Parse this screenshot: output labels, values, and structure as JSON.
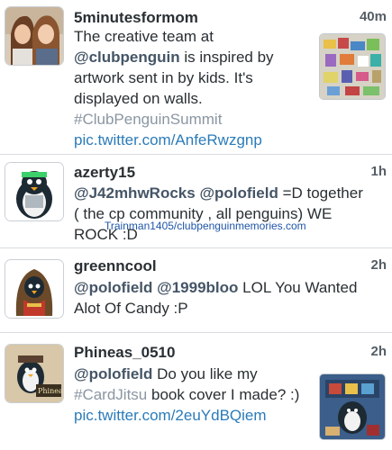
{
  "tweets": [
    {
      "username": "5minutesformom",
      "time": "40m",
      "line1": "The creative team at",
      "mention1": "@clubpenguin",
      "line2_rest": " is inspired by",
      "line3": "artwork sent in by kids. It's",
      "line4": "displayed on walls.",
      "hashtag": "#ClubPenguinSummit",
      "link": "pic.twitter.com/AnfeRwzgnp",
      "avatar_icon": "two-women-photo",
      "thumbnail_icon": "artwork-wall-photo"
    },
    {
      "username": "azerty15",
      "time": "1h",
      "mention1": "@J42mhwRocks",
      "mention2": "@polofield",
      "line1_rest": " =D together",
      "line2": "( the cp community , all penguins) WE",
      "line3": "ROCK :D",
      "avatar_icon": "penguin-avatar"
    },
    {
      "username": "greenncool",
      "time": "2h",
      "mention1": "@polofield",
      "mention2": "@1999bloo",
      "line1_rest": " LOL You Wanted",
      "line2": "Alot Of Candy :P",
      "avatar_icon": "hooded-penguin-avatar"
    },
    {
      "username": "Phineas_0510",
      "time": "2h",
      "mention1": "@polofield",
      "line1_rest": " Do you like my",
      "hashtag": "#CardJitsu",
      "line2_rest": " book cover I made? :)",
      "link": "pic.twitter.com/2euYdBQiem",
      "avatar_icon": "phineas-penguin-avatar",
      "thumbnail_icon": "book-cover-photo"
    }
  ],
  "watermark": "Trainman1405/clubpenguinmemories.com",
  "colors": {
    "text": "#292f33",
    "mention": "#455566",
    "hashtag": "#8a96a2",
    "link": "#2b7bb9",
    "divider": "#d8dde2"
  }
}
